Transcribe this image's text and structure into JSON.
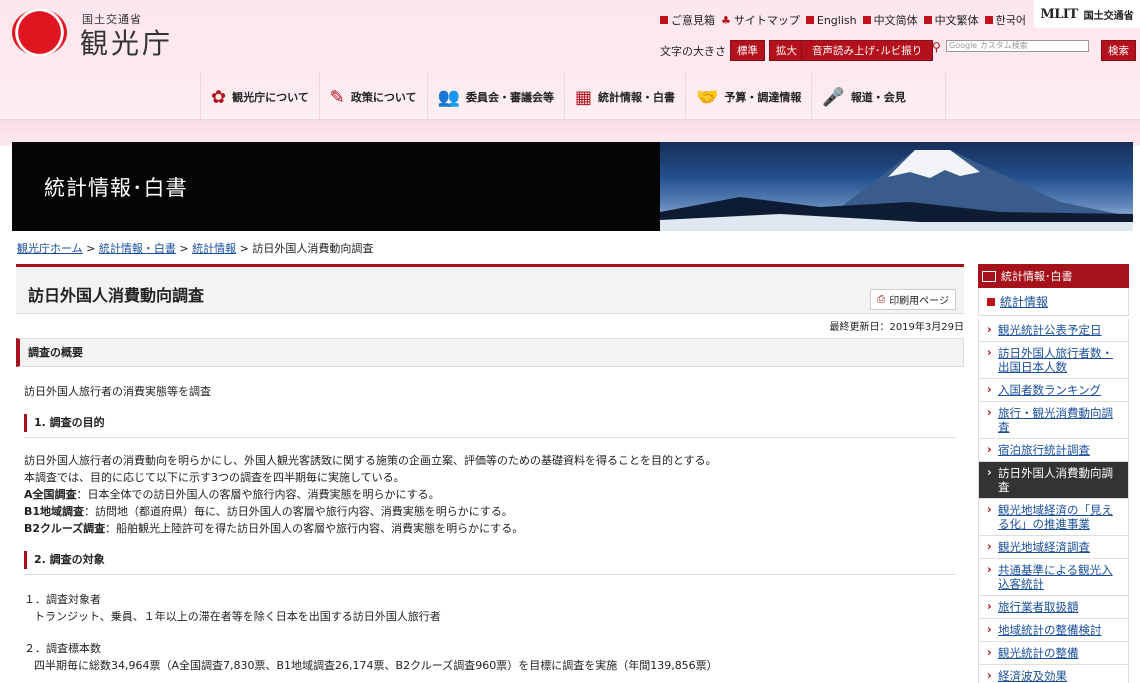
{
  "header": {
    "logo_small": "国土交通省",
    "logo_big": "観光庁",
    "util_links": [
      "ご意見箱",
      "サイトマップ",
      "English",
      "中文简体",
      "中文繁体",
      "한국어"
    ],
    "mlit_logo": "MLIT",
    "mlit_name": "国土交通省",
    "text_size_label": "文字の大きさ",
    "text_size_standard": "標準",
    "text_size_large": "拡大",
    "read_aloud": "音声読み上げ･ルビ振り",
    "search_placeholder": "Google カスタム検索",
    "search_button": "検索"
  },
  "nav": [
    {
      "label": "観光庁について",
      "icon": "flower-icon"
    },
    {
      "label": "政策について",
      "icon": "pen-icon"
    },
    {
      "label": "委員会・審議会等",
      "icon": "people-icon"
    },
    {
      "label": "統計情報・白書",
      "icon": "chart-icon"
    },
    {
      "label": "予算・調達情報",
      "icon": "handshake-icon"
    },
    {
      "label": "報道・会見",
      "icon": "microphone-icon"
    }
  ],
  "hero": {
    "title": "統計情報･白書"
  },
  "breadcrumb": {
    "home": "観光庁ホーム",
    "sep": ">",
    "level2": "統計情報・白書",
    "level3": "統計情報",
    "current": "訪日外国人消費動向調査"
  },
  "page": {
    "title": "訪日外国人消費動向調査",
    "print": "印刷用ページ",
    "updated": "最終更新日：2019年3月29日",
    "section_title": "調査の概要",
    "summary": "訪日外国人旅行者の消費実態等を調査",
    "purpose_heading": "1.  調査の目的",
    "purpose_lines": [
      "訪日外国人旅行者の消費動向を明らかにし、外国人観光客誘致に関する施策の企画立案、評価等のための基礎資料を得ることを目的とする。",
      "本調査では、目的に応じて以下に示す3つの調査を四半期毎に実施している。"
    ],
    "surveys": [
      {
        "name": "A全国調査",
        "desc": "：日本全体での訪日外国人の客層や旅行内容、消費実態を明らかにする。"
      },
      {
        "name": "B1地域調査",
        "desc": "：訪問地（都道府県）毎に、訪日外国人の客層や旅行内容、消費実態を明らかにする。"
      },
      {
        "name": "B2クルーズ調査",
        "desc": "：船舶観光上陸許可を得た訪日外国人の客層や旅行内容、消費実態を明らかにする。"
      }
    ],
    "target_heading": "2.  調査の対象",
    "target_items": [
      {
        "title": "１．調査対象者",
        "body": "トランジット、乗員、１年以上の滞在者等を除く日本を出国する訪日外国人旅行者"
      },
      {
        "title": "２．調査標本数",
        "body": "四半期毎に総数34,964票（A全国調査7,830票、B1地域調査26,174票、B2クルーズ調査960票）を目標に調査を実施（年間139,856票）"
      }
    ]
  },
  "sidebar": {
    "head": "統計情報･白書",
    "sub": "統計情報",
    "items": [
      "観光統計公表予定日",
      "訪日外国人旅行者数・出国日本人数",
      "入国者数ランキング",
      "旅行・観光消費動向調査",
      "宿泊旅行統計調査",
      "訪日外国人消費動向調査",
      "観光地域経済の「見える化」の推進事業",
      "観光地域経済調査",
      "共通基準による観光入込客統計",
      "旅行業者取扱額",
      "地域統計の整備検討",
      "観光統計の整備",
      "経済波及効果"
    ],
    "active_index": 5
  },
  "colors": {
    "accent": "#a6121b",
    "link": "#1a4f9c"
  }
}
